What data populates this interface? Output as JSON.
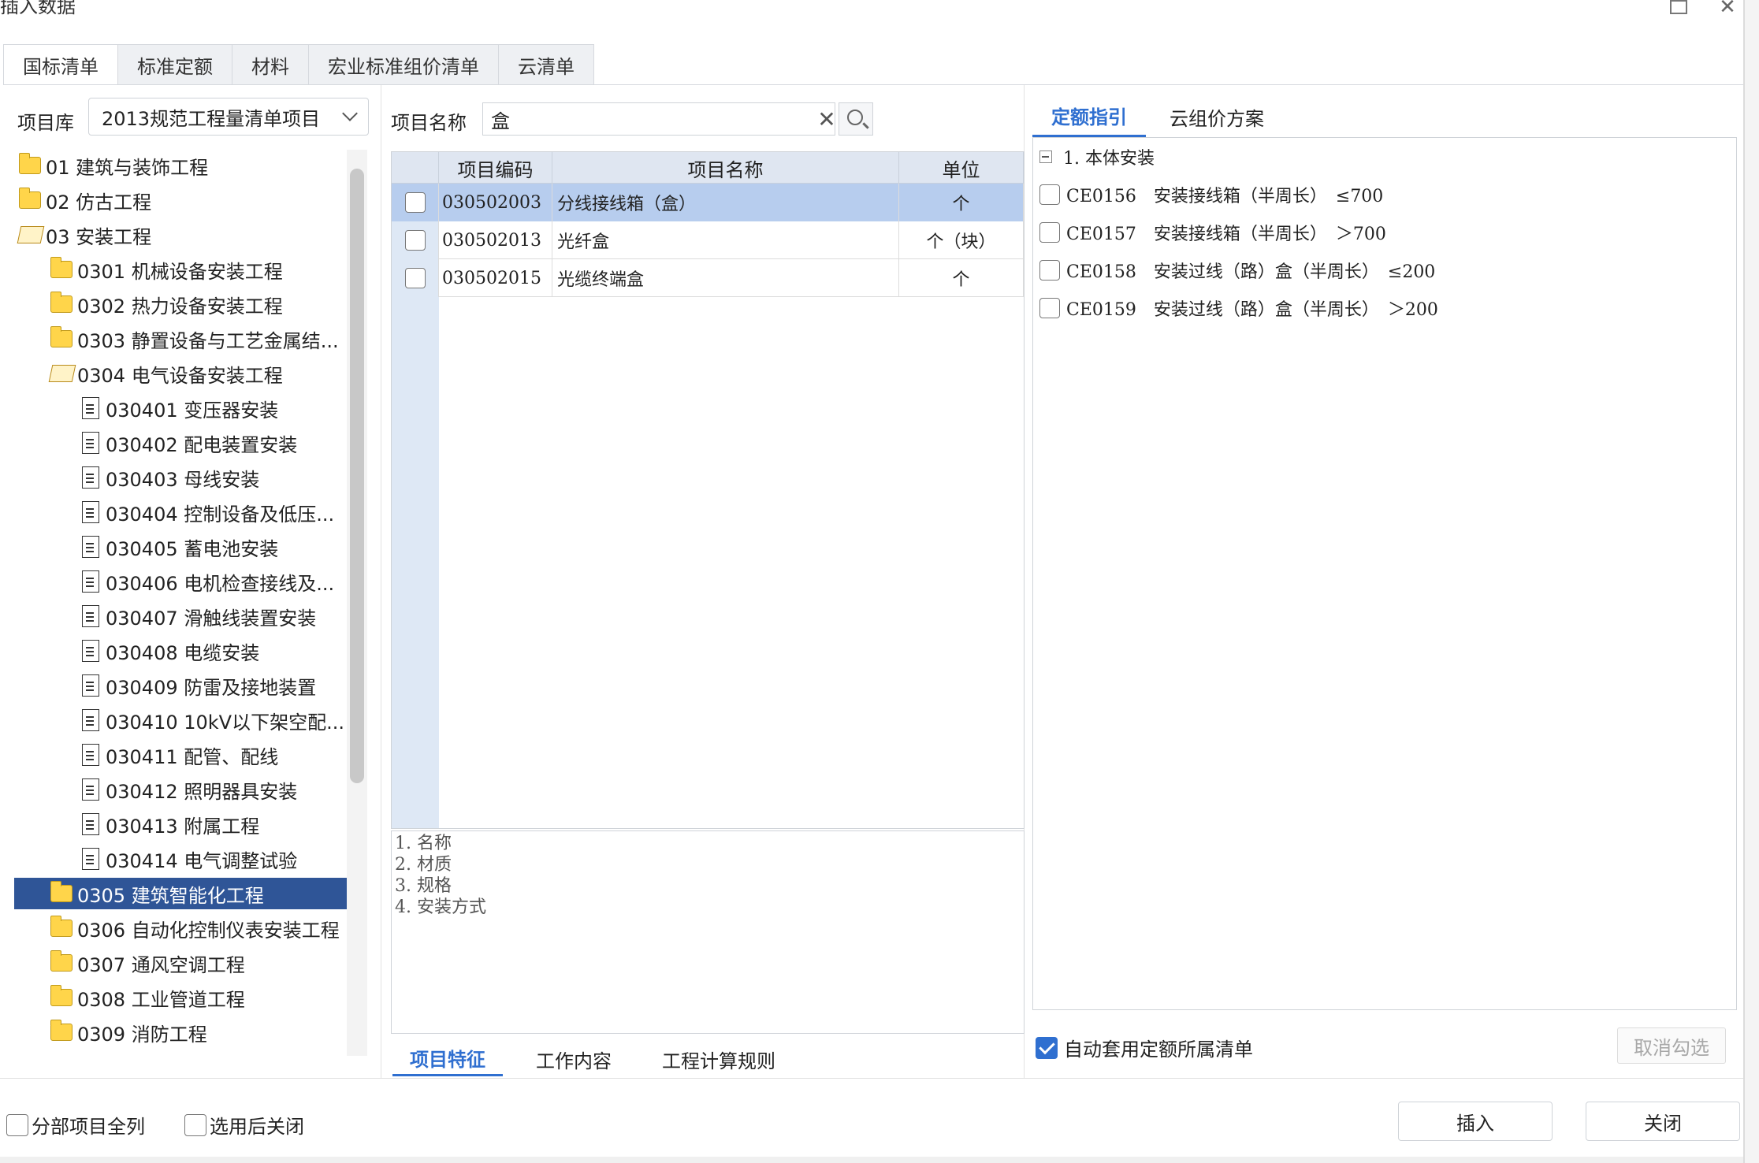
{
  "window": {
    "title": "插入数据"
  },
  "tabs": [
    "国标清单",
    "标准定额",
    "材料",
    "宏业标准组价清单",
    "云清单"
  ],
  "library": {
    "label": "项目库",
    "selected": "2013规范工程量清单项目"
  },
  "tree": [
    {
      "label": "01 建筑与装饰工程",
      "type": "folder",
      "level": 0
    },
    {
      "label": "02 仿古工程",
      "type": "folder",
      "level": 0
    },
    {
      "label": "03 安装工程",
      "type": "folder-open",
      "level": 0
    },
    {
      "label": "0301 机械设备安装工程",
      "type": "folder",
      "level": 1
    },
    {
      "label": "0302 热力设备安装工程",
      "type": "folder",
      "level": 1
    },
    {
      "label": "0303 静置设备与工艺金属结...",
      "type": "folder",
      "level": 1
    },
    {
      "label": "0304 电气设备安装工程",
      "type": "folder-open",
      "level": 1
    },
    {
      "label": "030401 变压器安装",
      "type": "doc",
      "level": 2
    },
    {
      "label": "030402 配电装置安装",
      "type": "doc",
      "level": 2
    },
    {
      "label": "030403 母线安装",
      "type": "doc",
      "level": 2
    },
    {
      "label": "030404 控制设备及低压...",
      "type": "doc",
      "level": 2
    },
    {
      "label": "030405 蓄电池安装",
      "type": "doc",
      "level": 2
    },
    {
      "label": "030406 电机检查接线及...",
      "type": "doc",
      "level": 2
    },
    {
      "label": "030407 滑触线装置安装",
      "type": "doc",
      "level": 2
    },
    {
      "label": "030408 电缆安装",
      "type": "doc",
      "level": 2
    },
    {
      "label": "030409 防雷及接地装置",
      "type": "doc",
      "level": 2
    },
    {
      "label": "030410 10kV以下架空配...",
      "type": "doc",
      "level": 2
    },
    {
      "label": "030411 配管、配线",
      "type": "doc",
      "level": 2
    },
    {
      "label": "030412 照明器具安装",
      "type": "doc",
      "level": 2
    },
    {
      "label": "030413 附属工程",
      "type": "doc",
      "level": 2
    },
    {
      "label": "030414 电气调整试验",
      "type": "doc",
      "level": 2
    },
    {
      "label": "0305 建筑智能化工程",
      "type": "folder",
      "level": 1,
      "selected": true
    },
    {
      "label": "0306 自动化控制仪表安装工程",
      "type": "folder",
      "level": 1
    },
    {
      "label": "0307 通风空调工程",
      "type": "folder",
      "level": 1
    },
    {
      "label": "0308 工业管道工程",
      "type": "folder",
      "level": 1
    },
    {
      "label": "0309 消防工程",
      "type": "folder",
      "level": 1
    }
  ],
  "search": {
    "label": "项目名称",
    "value": "盒"
  },
  "grid": {
    "columns": [
      "项目编码",
      "项目名称",
      "单位"
    ],
    "rows": [
      {
        "code": "030502003",
        "name": "分线接线箱（盒）",
        "unit": "个",
        "selected": true
      },
      {
        "code": "030502013",
        "name": "光纤盒",
        "unit": "个（块）"
      },
      {
        "code": "030502015",
        "name": "光缆终端盒",
        "unit": "个"
      }
    ]
  },
  "features": [
    "1. 名称",
    "2. 材质",
    "3. 规格",
    "4. 安装方式"
  ],
  "mid_tabs": [
    "项目特征",
    "工作内容",
    "工程计算规则"
  ],
  "right_tabs": [
    "定额指引",
    "云组价方案"
  ],
  "quota": {
    "group": "1. 本体安装",
    "items": [
      "CE0156　安装接线箱（半周长）　≤700",
      "CE0157　安装接线箱（半周长）　＞700",
      "CE0158　安装过线（路）盒（半周长）　≤200",
      "CE0159　安装过线（路）盒（半周长）　＞200"
    ]
  },
  "auto_apply": {
    "label": "自动套用定额所属清单",
    "checked": true
  },
  "cancel_select": "取消勾选",
  "bottom": {
    "expand_all": "分部项目全列",
    "close_after": "选用后关闭",
    "insert": "插入",
    "close": "关闭"
  }
}
